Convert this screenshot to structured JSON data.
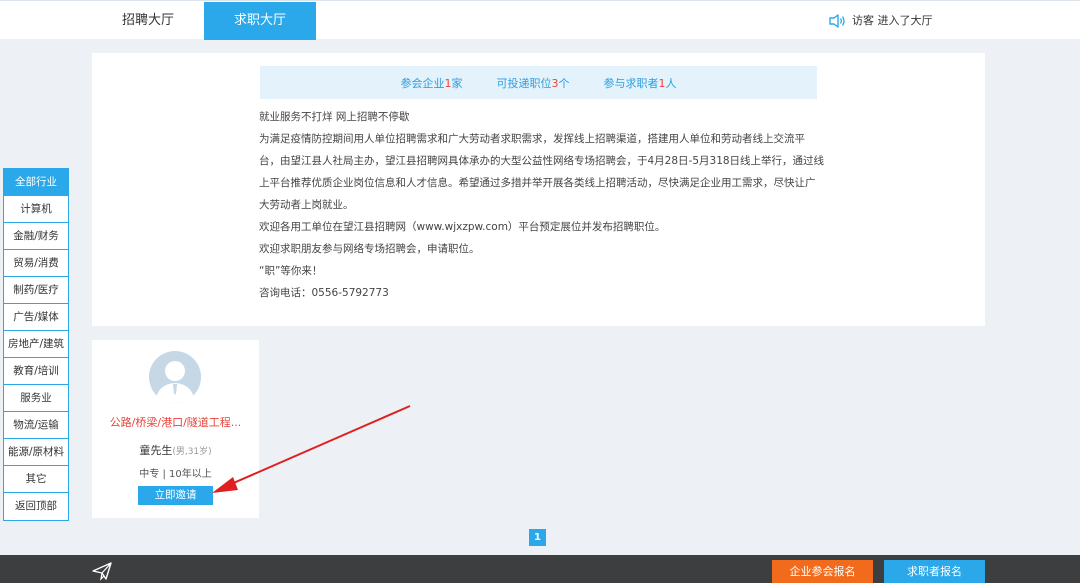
{
  "topbar": {
    "tabs": [
      {
        "label": "招聘大厅"
      },
      {
        "label": "求职大厅"
      }
    ],
    "visitor_label": "访客 进入了大厅"
  },
  "stats": {
    "companies_label": "参会企业",
    "companies_count": "1",
    "companies_unit": "家",
    "positions_label": "可投递职位",
    "positions_count": "3",
    "positions_unit": "个",
    "seekers_label": "参与求职者",
    "seekers_count": "1",
    "seekers_unit": "人"
  },
  "description": {
    "lines": [
      "就业服务不打烊  网上招聘不停歇",
      "为满足疫情防控期间用人单位招聘需求和广大劳动者求职需求，发挥线上招聘渠道，搭建用人单位和劳动者线上交流平台，由望江县人社局主办，望江县招聘网具体承办的大型公益性网络专场招聘会，于4月28日-5月318日线上举行，通过线上平台推荐优质企业岗位信息和人才信息。希望通过多措并举开展各类线上招聘活动，尽快满足企业用工需求，尽快让广大劳动者上岗就业。",
      "欢迎各用工单位在望江县招聘网（www.wjxzpw.com）平台预定展位并发布招聘职位。",
      "欢迎求职朋友参与网络专场招聘会，申请职位。",
      "  “职”等你来！",
      "咨询电话：0556-5792773"
    ]
  },
  "sidebar": {
    "items": [
      {
        "label": "全部行业"
      },
      {
        "label": "计算机"
      },
      {
        "label": "金融/财务"
      },
      {
        "label": "贸易/消费"
      },
      {
        "label": "制药/医疗"
      },
      {
        "label": "广告/媒体"
      },
      {
        "label": "房地产/建筑"
      },
      {
        "label": "教育/培训"
      },
      {
        "label": "服务业"
      },
      {
        "label": "物流/运输"
      },
      {
        "label": "能源/原材料"
      },
      {
        "label": "其它"
      },
      {
        "label": "返回顶部"
      }
    ]
  },
  "card": {
    "title": "公路/桥梁/港口/隧道工程...",
    "name": "童先生",
    "meta": "(男,31岁)",
    "edu": "中专 | 10年以上",
    "invite_label": "立即邀请"
  },
  "pagination": {
    "current": "1"
  },
  "footer": {
    "company_signup": "企业参会报名",
    "seeker_signup": "求职者报名"
  },
  "colors": {
    "accent": "#2aa8ea",
    "highlight": "#e8453c",
    "orange": "#f26b1d",
    "footer_bg": "#3d3e40"
  }
}
